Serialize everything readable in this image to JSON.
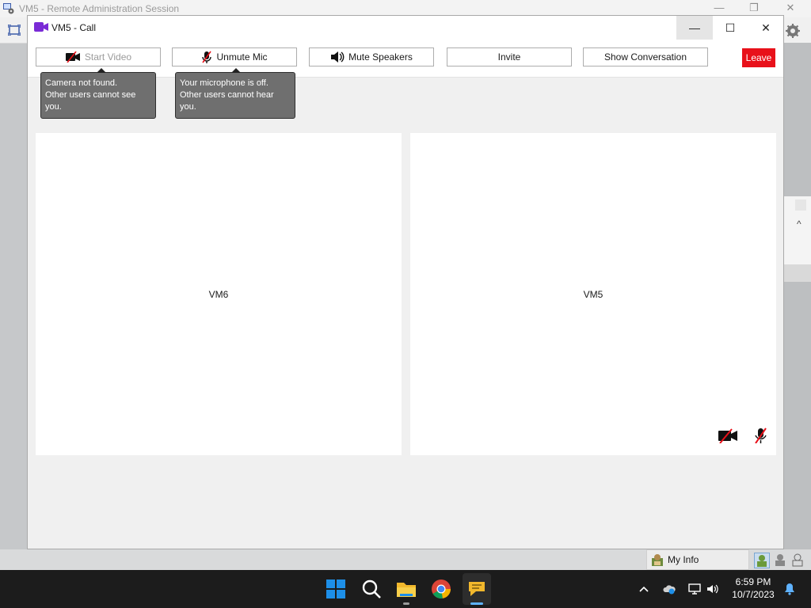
{
  "background_window": {
    "title": "VM5 - Remote Administration Session",
    "controls": {
      "minimize": "—",
      "restore": "❐",
      "close": "✕"
    }
  },
  "call_window": {
    "title": "VM5 - Call",
    "controls": {
      "minimize": "—",
      "maximize": "☐",
      "close": "✕"
    },
    "toolbar": {
      "start_video": "Start Video",
      "unmute_mic": "Unmute Mic",
      "mute_speakers": "Mute Speakers",
      "invite": "Invite",
      "show_conversation": "Show Conversation",
      "leave": "Leave"
    },
    "tooltips": {
      "camera": [
        "Camera not found.",
        "Other users cannot see you."
      ],
      "mic": [
        "Your microphone is off.",
        "Other users cannot hear you."
      ]
    },
    "participants": [
      {
        "name": "VM6"
      },
      {
        "name": "VM5",
        "video_off": true,
        "mic_off": true
      }
    ]
  },
  "status_bar": {
    "my_info": "My Info"
  },
  "taskbar": {
    "apps": [
      "start-icon",
      "search-icon",
      "file-explorer-icon",
      "chrome-icon",
      "chat-app-icon"
    ],
    "active_app": "chat-app-icon",
    "clock": {
      "time": "6:59 PM",
      "date": "10/7/2023"
    }
  },
  "colors": {
    "leave": "#e8111a",
    "accent_purple": "#7a2bd6",
    "taskbar": "#1c1c1c"
  }
}
